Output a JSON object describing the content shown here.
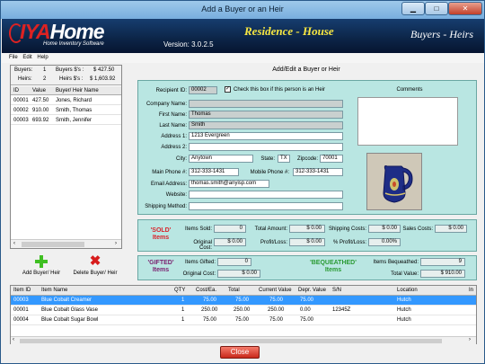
{
  "window": {
    "title": "Add a Buyer or an Heir"
  },
  "banner": {
    "brand_iy": "IYA",
    "brand_home": "Home",
    "brand_sub": "Home Inventory Software",
    "version": "Version: 3.0.2.5",
    "residence": "Residence - House",
    "section": "Buyers - Heirs"
  },
  "menu": [
    "File",
    "Edit",
    "Help"
  ],
  "stats": {
    "buyers_label": "Buyers:",
    "buyers_count": "1",
    "buyers_money_label": "Buyers $'s :",
    "buyers_money": "$ 427.50",
    "heirs_label": "Heirs:",
    "heirs_count": "2",
    "heirs_money_label": "Heirs $'s :",
    "heirs_money": "$ 1,603.92"
  },
  "list": {
    "headers": [
      "ID",
      "Value",
      "Buyer/ Heir Name"
    ],
    "rows": [
      {
        "id": "00001",
        "value": "427.50",
        "name": "Jones, Richard"
      },
      {
        "id": "00002",
        "value": "910.00",
        "name": "Smith, Thomas"
      },
      {
        "id": "00003",
        "value": "693.92",
        "name": "Smith, Jennifer"
      }
    ]
  },
  "buttons": {
    "add": "Add Buyer/ Heir",
    "delete": "Delete Buyer/ Heir",
    "close": "Close"
  },
  "form": {
    "title": "Add/Edit a Buyer or Heir",
    "recipient_id_label": "Recipient ID:",
    "recipient_id": "00002",
    "heir_checkbox_label": "Check this box if this person is an Heir",
    "comments_label": "Comments",
    "company_label": "Company Name:",
    "company": "",
    "first_label": "First Name:",
    "first": "Thomas",
    "last_label": "Last Name:",
    "last": "Smith",
    "addr1_label": "Address 1:",
    "addr1": "1213 Evergreen",
    "addr2_label": "Address 2:",
    "addr2": "",
    "city_label": "City:",
    "city": "Anytown",
    "state_label": "State:",
    "state": "TX",
    "zip_label": "Zipcode:",
    "zip": "70001",
    "main_phone_label": "Main Phone #:",
    "main_phone": "312-333-1431",
    "mobile_phone_label": "Mobile Phone #:",
    "mobile_phone": "312-333-1431",
    "email_label": "Email Address:",
    "email": "thomas.smith@anyisp.com",
    "website_label": "Website:",
    "website": "",
    "shipping_label": "Shipping Method:",
    "shipping": ""
  },
  "sold": {
    "title_1": "'SOLD'",
    "title_2": "Items",
    "items_sold_label": "Items Sold:",
    "items_sold": "0",
    "total_amount_label": "Total Amount:",
    "total_amount": "$ 0.00",
    "shipping_costs_label": "Shipping Costs:",
    "shipping_costs": "$ 0.00",
    "sales_costs_label": "Sales Costs:",
    "sales_costs": "$ 0.00",
    "original_cost_label": "Original Cost:",
    "original_cost": "$ 0.00",
    "profit_loss_label": "Profit/Loss:",
    "profit_loss": "$ 0.00",
    "pct_label": "% Profit/Loss:",
    "pct": "0.00%"
  },
  "gifted": {
    "title_1": "'GIFTED'",
    "title_2": "Items",
    "items_gifted_label": "Items Gifted:",
    "items_gifted": "0",
    "original_cost_label": "Original Cost:",
    "original_cost": "$ 0.00",
    "bequeathed_1": "'BEQUEATHED'",
    "bequeathed_2": "Items",
    "items_bequeathed_label": "Items Bequeathed:",
    "items_bequeathed": "9",
    "total_value_label": "Total Value:",
    "total_value": "$ 910.00"
  },
  "grid": {
    "headers": [
      "Item ID",
      "Item Name",
      "QTY",
      "Cost/Ea.",
      "Total",
      "Current Value",
      "Depr. Value",
      "S/N",
      "Location",
      "In"
    ],
    "rows": [
      {
        "id": "00003",
        "name": "Blue Cobalt Creamer",
        "qty": "1",
        "cost": "75.00",
        "total": "75.00",
        "current": "75.00",
        "depr": "75.00",
        "sn": "",
        "loc": "Hutch"
      },
      {
        "id": "00001",
        "name": "Blue Cobalt Glass Vase",
        "qty": "1",
        "cost": "250.00",
        "total": "250.00",
        "current": "250.00",
        "depr": "0.00",
        "sn": "12345Z",
        "loc": "Hutch"
      },
      {
        "id": "00004",
        "name": "Blue Cobalt Sugar Bowl",
        "qty": "1",
        "cost": "75.00",
        "total": "75.00",
        "current": "75.00",
        "depr": "75.00",
        "sn": "",
        "loc": "Hutch"
      }
    ]
  },
  "colors": {
    "banner": "#0c2446",
    "teal_panel": "#b9e6e2",
    "selected_row": "#3398ff",
    "close_button": "#d9342a"
  }
}
